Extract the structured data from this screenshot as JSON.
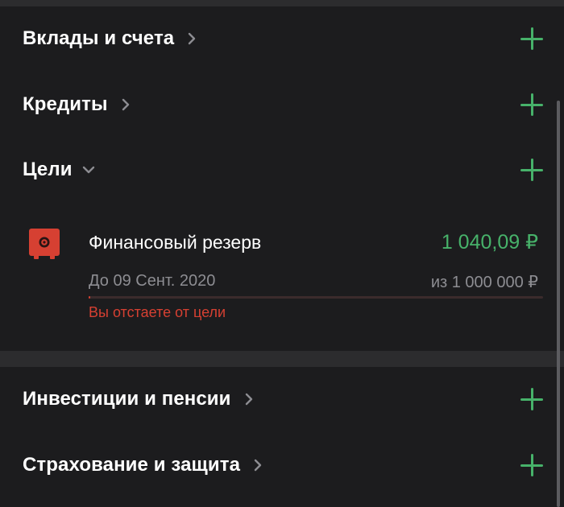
{
  "sections": {
    "deposits": {
      "label": "Вклады и счета"
    },
    "credits": {
      "label": "Кредиты"
    },
    "goals": {
      "label": "Цели"
    },
    "investments": {
      "label": "Инвестиции и пенсии"
    },
    "insurance": {
      "label": "Страхование и защита"
    }
  },
  "goal": {
    "name": "Финансовый резерв",
    "amount": "1 040,09 ₽",
    "date": "До 09 Сент. 2020",
    "target": "из 1 000 000 ₽",
    "warning": "Вы отстаете от цели",
    "progress_fraction": 0.00104,
    "icon": "safe-icon"
  },
  "colors": {
    "background": "#1c1c1e",
    "accent_green": "#47b26a",
    "warning_red": "#d64032",
    "secondary_text": "#8d8d92"
  }
}
